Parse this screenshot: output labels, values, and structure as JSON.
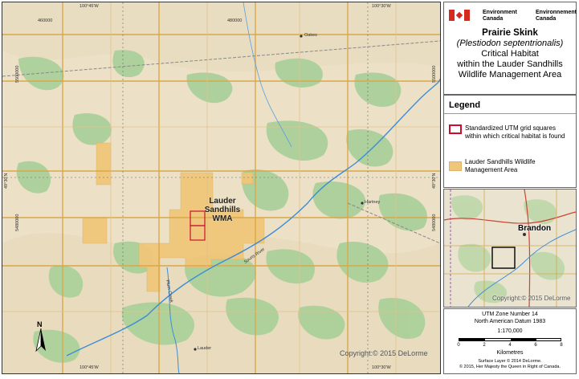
{
  "title_box": {
    "gov_en_1": "Environment",
    "gov_en_2": "Canada",
    "gov_fr_1": "Environnement",
    "gov_fr_2": "Canada",
    "species": "Prairie Skink",
    "latin": "(Plestiodon septentrionalis)",
    "line3": "Critical Habitat",
    "line4": "within the Lauder Sandhills",
    "line5": "Wildlife Management Area"
  },
  "legend": {
    "heading": "Legend",
    "item1": "Standardized UTM grid squares within which critical habitat is found",
    "item2": "Lauder Sandhills Wildlife Management Area",
    "colors": {
      "critical": "#c8102e",
      "wma": "#f0c67a"
    }
  },
  "inset": {
    "city": "Brandon",
    "copyright": "Copyright:© 2015 DeLorme"
  },
  "scale": {
    "zone": "UTM Zone Number 14",
    "datum": "North American Datum 1983",
    "ratio": "1:170,000",
    "ticks": [
      "0",
      "2",
      "4",
      "6",
      "8"
    ],
    "units": "Kilometres",
    "src1": "Surface Layer © 2014 DeLorme.",
    "src2": "© 2015, Her Majesty the Queen in Right of Canada."
  },
  "map": {
    "wma_label_1": "Lauder Sandhills",
    "wma_label_2": "WMA",
    "copyright": "Copyright:© 2015 DeLorme",
    "north": "N",
    "lon_top_left": "100°45'W",
    "lon_top_right": "100°30'W",
    "lon_bottom_left": "100°45'W",
    "lon_bottom_right": "100°30'W",
    "lat_left": "49°30'N",
    "lat_right": "49°30'N",
    "grid_top_1": "460000",
    "grid_top_2": "480000",
    "grid_left_1": "5500000",
    "grid_left_2": "5480000",
    "grid_right_1": "5500000",
    "grid_right_2": "5480000",
    "town_oakes": "Oakes",
    "town_hartney": "Hartney",
    "town_lauder": "Lauder",
    "river_souris": "Souris River",
    "river_plum": "Plum Creek"
  }
}
